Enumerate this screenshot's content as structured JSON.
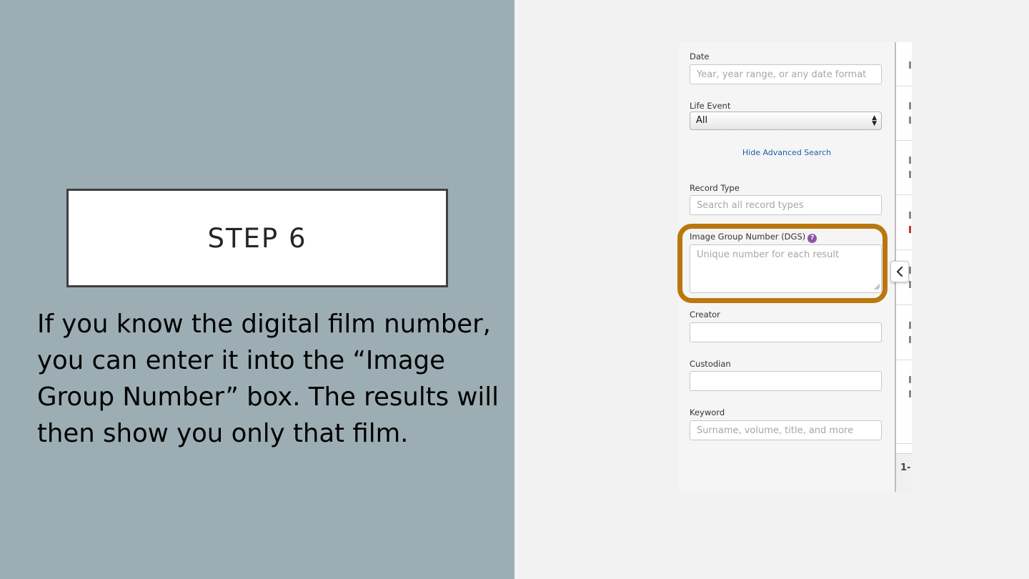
{
  "slide": {
    "step_title": "STEP 6",
    "body_text": "If you know the digital film number, you can enter it into the “Image Group Number” box. The results will then show you only that film.",
    "accent_color": "#b9770e",
    "left_bg_color": "#9caeb4"
  },
  "form": {
    "date": {
      "label": "Date",
      "placeholder": "Year, year range, or any date format"
    },
    "life_event": {
      "label": "Life Event",
      "value": "All"
    },
    "hide_advanced_link": "Hide Advanced Search",
    "record_type": {
      "label": "Record Type",
      "placeholder": "Search all record types"
    },
    "image_group": {
      "label": "Image Group Number (DGS)",
      "help_icon": "?",
      "placeholder": "Unique number for each result"
    },
    "creator": {
      "label": "Creator",
      "value": ""
    },
    "custodian": {
      "label": "Custodian",
      "value": ""
    },
    "keyword": {
      "label": "Keyword",
      "placeholder": "Surname, volume, title, and more"
    }
  },
  "results": {
    "pager_text": "1-"
  },
  "icons": {
    "collapse": "chevron-left-icon",
    "select_arrows": "updown-arrows-icon",
    "help": "question-circle-icon"
  }
}
